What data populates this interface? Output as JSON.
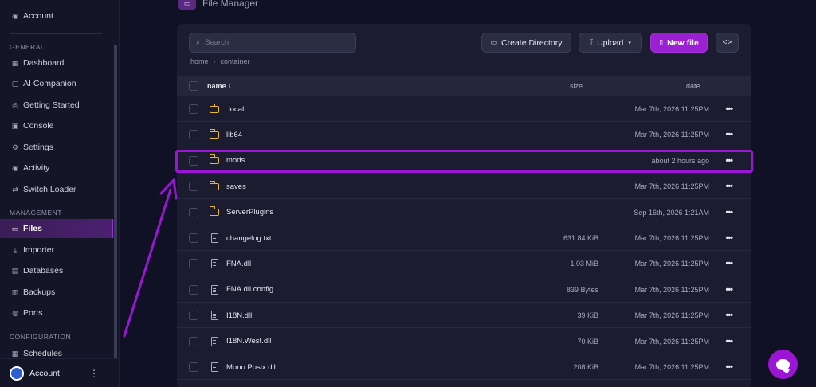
{
  "sidebar": {
    "top_item": "Account",
    "sections": {
      "general": "GENERAL",
      "management": "MANAGEMENT",
      "configuration": "CONFIGURATION"
    },
    "general_items": [
      {
        "label": "Dashboard",
        "icon": "grid-icon"
      },
      {
        "label": "AI Companion",
        "icon": "chat-icon"
      },
      {
        "label": "Getting Started",
        "icon": "help-icon"
      },
      {
        "label": "Console",
        "icon": "terminal-icon"
      },
      {
        "label": "Settings",
        "icon": "gear-icon"
      },
      {
        "label": "Activity",
        "icon": "eye-icon"
      },
      {
        "label": "Switch Loader",
        "icon": "swap-icon"
      }
    ],
    "management_items": [
      {
        "label": "Files",
        "icon": "folder-icon",
        "active": true
      },
      {
        "label": "Importer",
        "icon": "download-icon"
      },
      {
        "label": "Databases",
        "icon": "database-icon"
      },
      {
        "label": "Backups",
        "icon": "archive-icon"
      },
      {
        "label": "Ports",
        "icon": "globe-icon"
      }
    ],
    "configuration_items": [
      {
        "label": "Schedules",
        "icon": "calendar-icon"
      }
    ],
    "footer": {
      "account_label": "Account",
      "avatar_letter": "",
      "more_glyph": "⋮"
    }
  },
  "page": {
    "title": "File Manager"
  },
  "toolbar": {
    "search_placeholder": "Search",
    "create_directory": "Create Directory",
    "upload": "Upload",
    "new_file": "New file",
    "code_toggle": "<>"
  },
  "breadcrumb": [
    "home",
    "container"
  ],
  "table": {
    "headers": {
      "name": "name ↓",
      "size": "size ↓",
      "date": "date ↓"
    },
    "rows": [
      {
        "type": "folder",
        "name": ".local",
        "size": "",
        "date": "Mar 7th, 2026 11:25PM"
      },
      {
        "type": "folder",
        "name": "lib64",
        "size": "",
        "date": "Mar 7th, 2026 11:25PM"
      },
      {
        "type": "folder",
        "name": "mods",
        "size": "",
        "date": "about 2 hours ago"
      },
      {
        "type": "folder",
        "name": "saves",
        "size": "",
        "date": "Mar 7th, 2026 11:25PM"
      },
      {
        "type": "folder",
        "name": "ServerPlugins",
        "size": "",
        "date": "Sep 16th, 2026 1:21AM"
      },
      {
        "type": "file",
        "name": "changelog.txt",
        "size": "631.84 KiB",
        "date": "Mar 7th, 2026 11:25PM"
      },
      {
        "type": "file",
        "name": "FNA.dll",
        "size": "1.03 MiB",
        "date": "Mar 7th, 2026 11:25PM"
      },
      {
        "type": "file",
        "name": "FNA.dll.config",
        "size": "839 Bytes",
        "date": "Mar 7th, 2026 11:25PM"
      },
      {
        "type": "file",
        "name": "I18N.dll",
        "size": "39 KiB",
        "date": "Mar 7th, 2026 11:25PM"
      },
      {
        "type": "file",
        "name": "I18N.West.dll",
        "size": "70 KiB",
        "date": "Mar 7th, 2026 11:25PM"
      },
      {
        "type": "file",
        "name": "Mono.Posix.dll",
        "size": "208 KiB",
        "date": "Mar 7th, 2026 11:25PM"
      }
    ],
    "row_menu_glyph": "•••"
  },
  "annotation": {
    "highlighted_row": "mods",
    "color": "#9b16d4"
  },
  "colors": {
    "accent": "#9b1fd3",
    "folder": "#e8b53a",
    "background": "#101124",
    "panel": "#1b1c30"
  }
}
